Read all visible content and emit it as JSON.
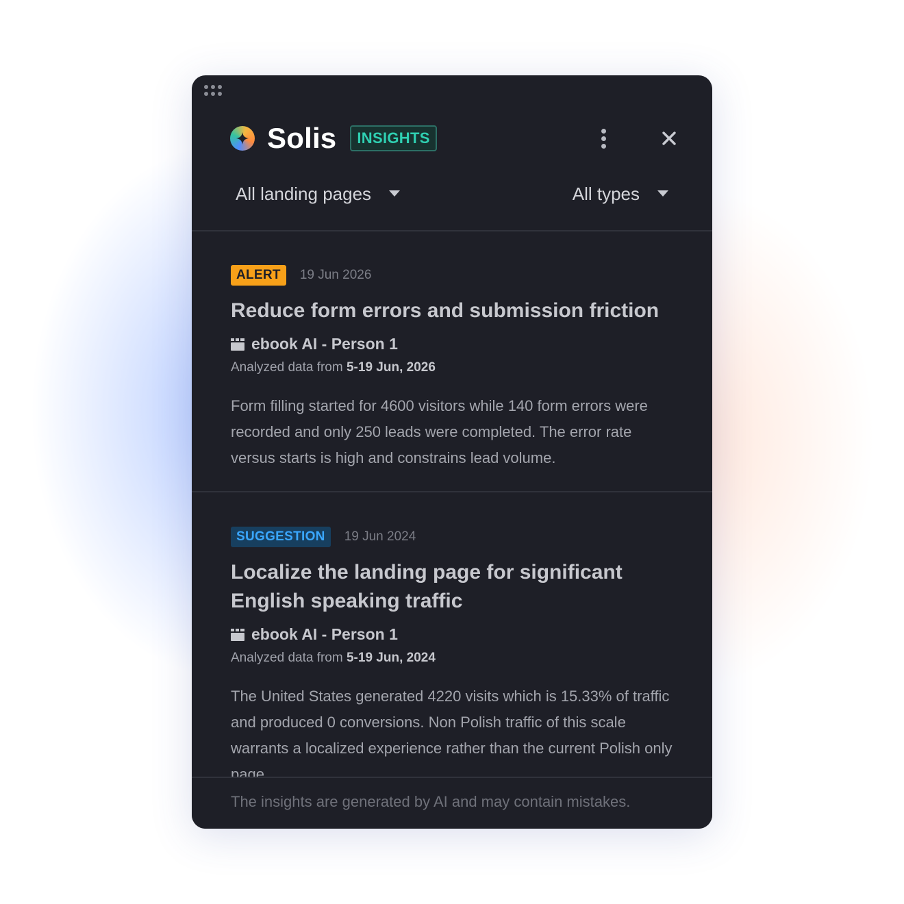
{
  "header": {
    "brand": "Solis",
    "badge": "INSIGHTS",
    "icons": [
      "drag-handle-icon",
      "solis-logo-icon",
      "more-vertical-icon",
      "close-icon"
    ]
  },
  "filters": {
    "landing_pages": "All landing pages",
    "types": "All types"
  },
  "insights": [
    {
      "tag": "ALERT",
      "date": "19 Jun 2026",
      "title": "Reduce form errors and submission friction",
      "source": "ebook AI - Person 1",
      "analyzed_prefix": "Analyzed data from",
      "analyzed_range": "5-19 Jun, 2026",
      "body": "Form filling started for 4600 visitors while 140 form errors were recorded and only 250 leads were completed. The error rate versus starts is high and constrains lead volume."
    },
    {
      "tag": "SUGGESTION",
      "date": "19 Jun 2024",
      "title": "Localize the landing page for significant English speaking traffic",
      "source": "ebook AI - Person 1",
      "analyzed_prefix": "Analyzed data from",
      "analyzed_range": "5-19 Jun, 2024",
      "body": "The United States generated 4220 visits which is 15.33% of traffic and produced 0 conversions. Non Polish traffic of this scale warrants a localized experience rather than the current Polish only page."
    }
  ],
  "footer": {
    "disclaimer": "The insights are generated by AI and may contain  mistakes."
  },
  "colors": {
    "panel_bg": "#1e1f27",
    "insights_badge": "#2fd0b2",
    "alert": "#f7a019",
    "suggestion": "#3aa7ff"
  }
}
